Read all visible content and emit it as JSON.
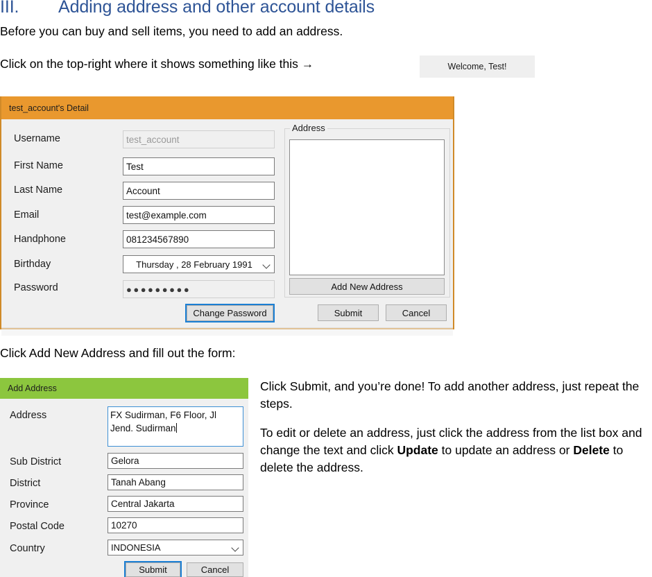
{
  "document": {
    "heading_number": "III.",
    "heading_text": "Adding address and other account details",
    "paragraph_1": "Before you can buy and sell items, you need to add an address.",
    "paragraph_2": "Click on the top-right where it shows something like this →",
    "paragraph_3": "Click Add New Address and fill out the form:",
    "welcome_button_label": "Welcome, Test!",
    "heading_color": "#2E5496"
  },
  "account_dialog": {
    "title": "test_account's Detail",
    "title_bar_color": "#E9982E",
    "border_color": "#D08A28",
    "fields": [
      {
        "label": "Username",
        "value": "test_account",
        "readonly": true
      },
      {
        "label": "First Name",
        "value": "Test",
        "readonly": false
      },
      {
        "label": "Last Name",
        "value": "Account",
        "readonly": false
      },
      {
        "label": "Email",
        "value": "test@example.com",
        "readonly": false
      },
      {
        "label": "Handphone",
        "value": "081234567890",
        "readonly": false
      }
    ],
    "birthday": {
      "label": "Birthday",
      "value": "Thursday  , 28  February  1991"
    },
    "password": {
      "label": "Password",
      "value": "●●●●●●●●●"
    },
    "address_group_label": "Address",
    "address_list_items": [],
    "buttons": {
      "change_password": "Change Password",
      "add_new_address": "Add New Address",
      "submit": "Submit",
      "cancel": "Cancel"
    }
  },
  "address_dialog": {
    "title": "Add Address",
    "title_bar_color": "#8CC63E",
    "address": {
      "label": "Address",
      "line1": "FX Sudirman, F6 Floor, Jl",
      "line2": "Jend. Sudirman"
    },
    "fields": [
      {
        "label": "Sub District",
        "value": "Gelora"
      },
      {
        "label": "District",
        "value": "Tanah Abang"
      },
      {
        "label": "Province",
        "value": "Central Jakarta"
      },
      {
        "label": "Postal Code",
        "value": "10270"
      }
    ],
    "country": {
      "label": "Country",
      "value": "INDONESIA"
    },
    "buttons": {
      "submit": "Submit",
      "cancel": "Cancel"
    }
  },
  "notes": {
    "para_1_a": "Click Submit, and you’re done! To add another address, just repeat the steps.",
    "para_2_a": "To edit or delete an address, just click the address from the list box and change the text and click ",
    "para_2_bold_1": "Update",
    "para_2_b": " to update an address or ",
    "para_2_bold_2": "Delete",
    "para_2_c": " to delete the address."
  }
}
